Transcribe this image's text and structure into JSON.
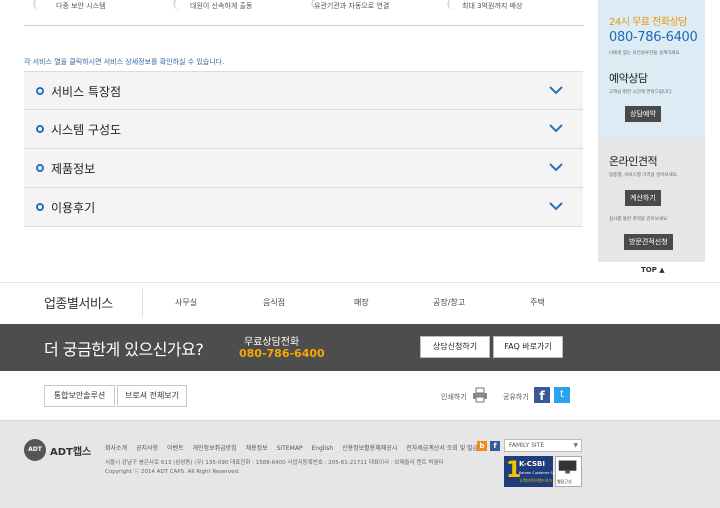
{
  "features": [
    "다중 보안 시스템",
    "대원이 신속하게 출동",
    "유관기관과 자동으로 연결",
    "최대 3억원까지 배상"
  ],
  "hint": "각 서비스 열을 클릭하시면 서비스 상세정보를 확인하실 수 있습니다.",
  "accordion": [
    {
      "label": "서비스 특장점"
    },
    {
      "label": "시스템 구성도"
    },
    {
      "label": "제품정보"
    },
    {
      "label": "이용후기"
    }
  ],
  "sidebar": {
    "consult_title": "24시 무료 전화상담",
    "consult_phone": "080-786-6400",
    "consult_desc": "나에게 맞는 보안솔루션을 설계하세요",
    "reserve_title": "예약상담",
    "reserve_desc": "고객님 편한 시간에 연락드립니다.",
    "reserve_btn": "상담예약",
    "estimate_title": "온라인견적",
    "estimate_desc": "업종별, 서비스별 가격을 알아보세요.",
    "estimate_btn": "계산하기",
    "visit_desc": "실사를 통한 견적을 받아보세요.",
    "visit_btn": "방문견적신청",
    "top": "TOP ▲"
  },
  "industry": {
    "title": "업종별서비스",
    "links": [
      "사무실",
      "음식점",
      "매장",
      "공장/창고",
      "주택"
    ]
  },
  "band": {
    "title": "더 궁금한게 있으신가요?",
    "label": "무료상담전화",
    "phone": "080-786-6400",
    "btn_consult": "상담신청하기",
    "btn_faq": "FAQ 바로가기"
  },
  "util": {
    "btn_solution": "통합보안솔루션",
    "btn_brochure": "브로셔 전체보기",
    "print": "인쇄하기",
    "share": "공유하기"
  },
  "footer": {
    "logo_mark": "ADT",
    "logo": "ADT캡스",
    "links": [
      "회사소개",
      "공지사항",
      "이벤트",
      "개인정보취급방침",
      "채용정보",
      "SITEMAP",
      "English",
      "신용정보활용체제공시",
      "전자세금계산서 조회 및 발급"
    ],
    "addr1": "서울시 강남구 봉은사로 613 (삼성동) (우) 135-090   대표전화 : 1588-6400   사업자등록번호 : 205-81-21711   대표이사 : 브래들리 켄트 벅월터",
    "addr2": "Copyright ⓒ 2014 ADT CAPS. All Right Reserved.",
    "family": "FAMILY SITE",
    "kcsbi_num": "1",
    "kcsbi": "K-CSBI",
    "kcsbi_sub": "Korean Customer Satisfaction",
    "kcsbi_tag": "고객만족브랜드지수 1위",
    "cert": "웹접근성"
  }
}
